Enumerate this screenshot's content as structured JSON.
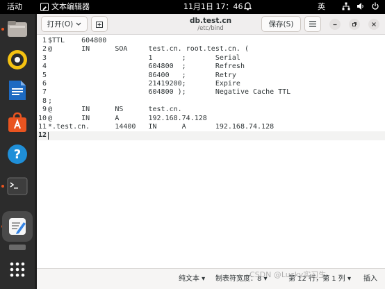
{
  "topbar": {
    "activities": "活动",
    "app_name": "文本编辑器",
    "clock": "11月1日  17：46",
    "bell_icon": "alarm-clock-icon",
    "language": "英"
  },
  "dock": {
    "items": [
      "files",
      "rhythmbox",
      "writer",
      "app-center",
      "help",
      "terminal",
      "text-editor",
      "trash",
      "show-apps"
    ]
  },
  "window": {
    "open_label": "打开(O)",
    "title": "db.test.cn",
    "subtitle": "/etc/bind",
    "save_label": "保存(S)"
  },
  "editor": {
    "lines": [
      {
        "n": "1",
        "text": "$TTL    604800"
      },
      {
        "n": "2",
        "text": "@       IN      SOA     test.cn. root.test.cn. ("
      },
      {
        "n": "3",
        "text": "                        1       ;       Serial"
      },
      {
        "n": "4",
        "text": "                        604800  ;       Refresh"
      },
      {
        "n": "5",
        "text": "                        86400   ;       Retry"
      },
      {
        "n": "6",
        "text": "                        21419200;       Expire"
      },
      {
        "n": "7",
        "text": "                        604800 );       Negative Cache TTL"
      },
      {
        "n": "8",
        "text": ";"
      },
      {
        "n": "9",
        "text": "@       IN      NS      test.cn."
      },
      {
        "n": "10",
        "text": "@       IN      A       192.168.74.128"
      },
      {
        "n": "11",
        "text": "*.test.cn.      14400   IN      A       192.168.74.128"
      },
      {
        "n": "12",
        "text": ""
      }
    ],
    "current_line": 12
  },
  "statusbar": {
    "language": "纯文本 ▾",
    "tab_width": "制表符宽度：8 ▾",
    "position": "第 12 行，第 1 列 ▾",
    "mode": "插入"
  },
  "watermark": "CSDN @Lucky实习生"
}
